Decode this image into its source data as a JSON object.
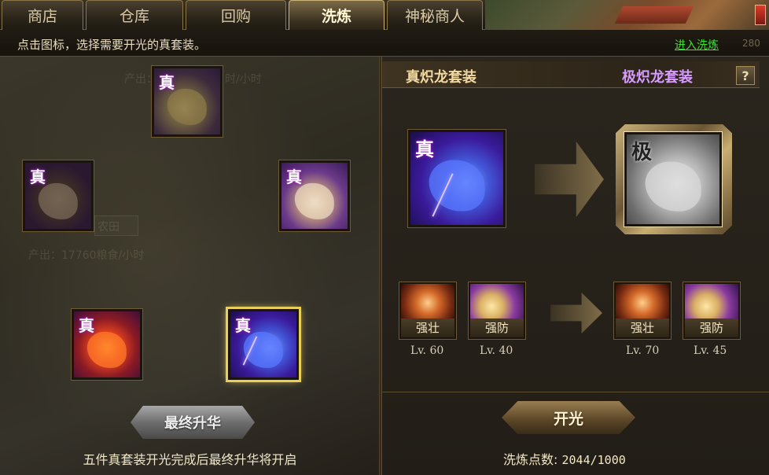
{
  "tabs": [
    {
      "label": "商店",
      "active": false
    },
    {
      "label": "仓库",
      "active": false
    },
    {
      "label": "回购",
      "active": false
    },
    {
      "label": "洗炼",
      "active": true
    },
    {
      "label": "神秘商人",
      "active": false
    }
  ],
  "instruction": "点击图标，选择需要开光的真套装。",
  "enter_link": "进入洗炼",
  "corner_number": "280",
  "left": {
    "items": [
      {
        "tag": "真",
        "name": "qilin",
        "selected": false
      },
      {
        "tag": "真",
        "name": "lion",
        "selected": false
      },
      {
        "tag": "真",
        "name": "tiger",
        "selected": false
      },
      {
        "tag": "真",
        "name": "phoenix",
        "selected": false
      },
      {
        "tag": "真",
        "name": "dragon",
        "selected": true
      }
    ],
    "background_text": {
      "top": "产出：",
      "top_right": "时/小时",
      "farm": "农田",
      "farm_output": "产出：17760粮食/小时"
    },
    "ultimate_button": "最终升华",
    "note": "五件真套装开光完成后最终升华将开启"
  },
  "right": {
    "set_name": "真炽龙套装",
    "target_name": "极炽龙套装",
    "help": "?",
    "source_tag": "真",
    "target_tag": "极",
    "skills_before": [
      {
        "label": "强壮",
        "level": "Lv. 60"
      },
      {
        "label": "强防",
        "level": "Lv. 40"
      }
    ],
    "skills_after": [
      {
        "label": "强壮",
        "level": "Lv. 70"
      },
      {
        "label": "强防",
        "level": "Lv. 45"
      }
    ],
    "open_button": "开光",
    "points_label": "洗炼点数:",
    "points_value": "2044/1000"
  },
  "colors": {
    "tab_active_text": "#fff6d4",
    "link": "#3fe02f",
    "target_name": "#d79bff",
    "selected_outline": "#e8cf5a"
  }
}
